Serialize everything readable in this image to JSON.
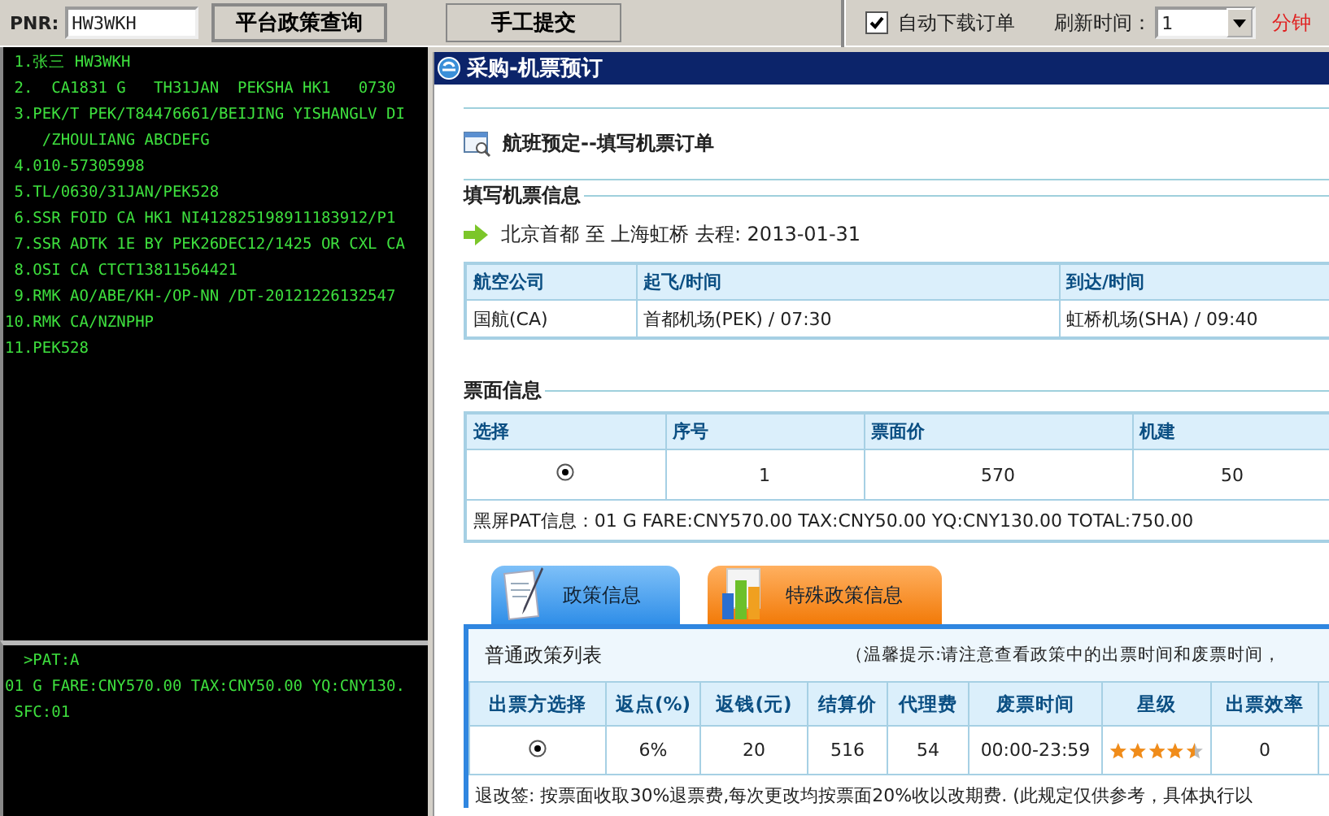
{
  "toolbar": {
    "pnr_label": "PNR:",
    "pnr_value": "HW3WKH",
    "buttons": [
      "平台政策查询",
      "手工提交"
    ],
    "auto_download": {
      "label": "自动下载订单",
      "checked": true
    },
    "refresh_label": "刷新时间：",
    "refresh_value": "1",
    "refresh_unit": "分钟"
  },
  "terminal": {
    "lines": [
      " 1.张三 HW3WKH",
      " 2.  CA1831 G   TH31JAN  PEKSHA HK1   0730",
      " 3.PEK/T PEK/T84476661/BEIJING YISHANGLV DI",
      "    /ZHOULIANG ABCDEFG",
      " 4.010-57305998",
      " 5.TL/0630/31JAN/PEK528",
      " 6.SSR FOID CA HK1 NI412825198911183912/P1",
      " 7.SSR ADTK 1E BY PEK26DEC12/1425 OR CXL CA",
      " 8.OSI CA CTCT13811564421",
      " 9.RMK AO/ABE/KH-/OP-NN /DT-20121226132547",
      "10.RMK CA/NZNPHP",
      "11.PEK528"
    ],
    "command_lines": [
      "  >PAT:A",
      "01 G FARE:CNY570.00 TAX:CNY50.00 YQ:CNY130.",
      " SFC:01"
    ]
  },
  "window": {
    "title": "采购-机票预订",
    "heading": "航班预定--填写机票订单",
    "section_ticket": "填写机票信息",
    "route": "北京首都 至 上海虹桥 去程: 2013-01-31",
    "flight_table": {
      "columns": [
        "航空公司",
        "起飞/时间",
        "到达/时间"
      ],
      "rows": [
        [
          "国航(CA)",
          "首都机场(PEK) / 07:30",
          "虹桥机场(SHA) / 09:40"
        ]
      ]
    },
    "section_fare": "票面信息",
    "fare_table": {
      "columns": [
        "选择",
        "序号",
        "票面价",
        "机建"
      ],
      "rows": [
        {
          "cells": [
            {
              "kind": "radio",
              "selected": true
            },
            "1",
            "570",
            "50"
          ]
        }
      ],
      "pat_info": "黑屏PAT信息：01 G FARE:CNY570.00 TAX:CNY50.00 YQ:CNY130.00 TOTAL:750.00"
    },
    "tabs": [
      {
        "label": "政策信息",
        "selected": true
      },
      {
        "label": "特殊政策信息",
        "selected": false
      }
    ],
    "policy": {
      "title": "普通政策列表",
      "notice": "（温馨提示:请注意查看政策中的出票时间和废票时间，",
      "columns": [
        "出票方选择",
        "返点(%)",
        "返钱(元)",
        "结算价",
        "代理费",
        "废票时间",
        "星级",
        "出票效率"
      ],
      "rows": [
        {
          "cells": [
            {
              "kind": "radio",
              "selected": true
            },
            "6%",
            "20",
            "516",
            "54",
            "00:00-23:59"
          ],
          "stars": 4.5,
          "efficiency": "0"
        }
      ],
      "rules": "退改签: 按票面收取30%退票费,每次更改均按票面20%收以改期费. (此规定仅供参考，具体执行以"
    }
  }
}
